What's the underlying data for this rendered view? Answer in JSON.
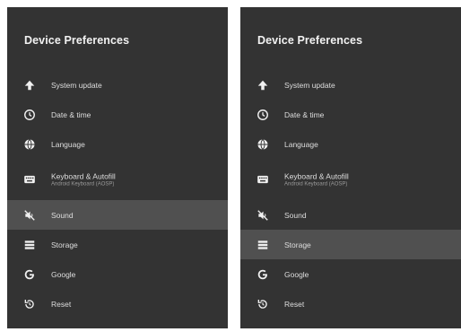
{
  "left": {
    "title": "Device Preferences",
    "items": [
      {
        "label": "System update",
        "icon": "arrow-up-icon"
      },
      {
        "label": "Date & time",
        "icon": "clock-icon"
      },
      {
        "label": "Language",
        "icon": "globe-icon"
      },
      {
        "label": "Keyboard & Autofill",
        "sublabel": "Android Keyboard (AOSP)",
        "icon": "keyboard-icon"
      },
      {
        "label": "Sound",
        "icon": "sound-muted-icon"
      },
      {
        "label": "Storage",
        "icon": "storage-icon"
      },
      {
        "label": "Google",
        "icon": "google-icon"
      },
      {
        "label": "Reset",
        "icon": "reset-icon"
      }
    ],
    "selected": "Sound"
  },
  "right": {
    "title": "Device Preferences",
    "items": [
      {
        "label": "System update",
        "icon": "arrow-up-icon"
      },
      {
        "label": "Date & time",
        "icon": "clock-icon"
      },
      {
        "label": "Language",
        "icon": "globe-icon"
      },
      {
        "label": "Keyboard & Autofill",
        "sublabel": "Android Keyboard (AOSP)",
        "icon": "keyboard-icon"
      },
      {
        "label": "Sound",
        "icon": "sound-muted-icon"
      },
      {
        "label": "Storage",
        "icon": "storage-icon"
      },
      {
        "label": "Google",
        "icon": "google-icon"
      },
      {
        "label": "Reset",
        "icon": "reset-icon"
      }
    ],
    "selected": "Storage"
  },
  "colors": {
    "panel_background": "#333333",
    "selected_row": "#505050",
    "text": "#dedede"
  }
}
